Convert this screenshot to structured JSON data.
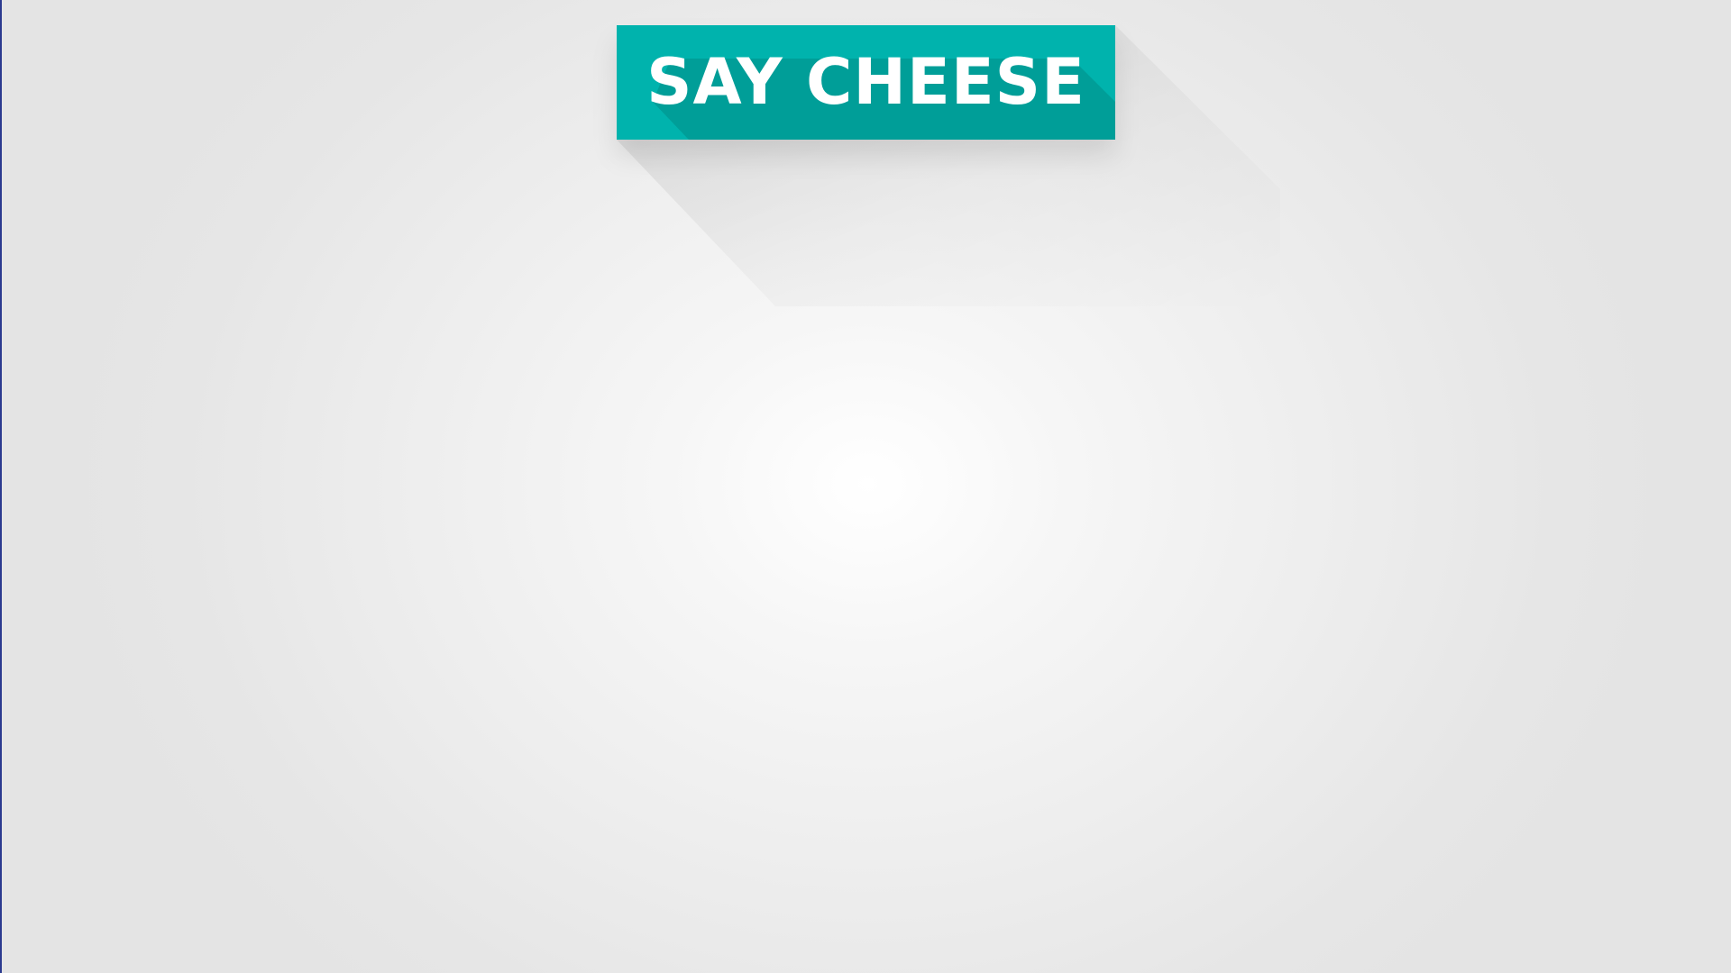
{
  "banner": {
    "title": "SAY CHEESE",
    "color": "#00b3ad",
    "shade_color": "#009a94"
  },
  "background": {
    "center_color": "#ffffff",
    "edge_color": "#e4e4e4"
  }
}
